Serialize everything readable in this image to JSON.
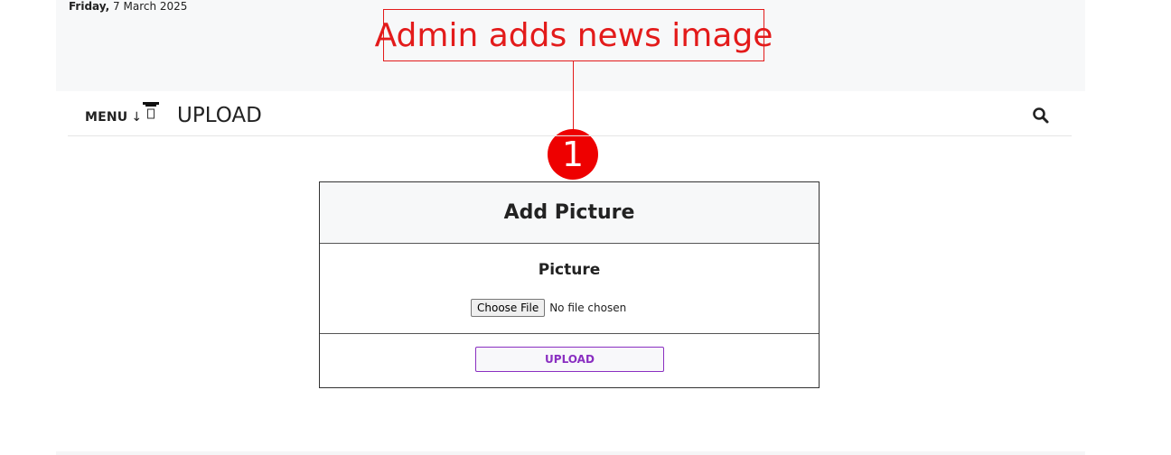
{
  "header": {
    "date_day": "Friday,",
    "date_rest": " 7 March 2025"
  },
  "annotation": {
    "text": "Admin adds news image",
    "step_number": "1",
    "color": "#e31b1b"
  },
  "navbar": {
    "menu_label": "MENU",
    "menu_arrow": "↓",
    "title": "UPLOAD",
    "icons": [
      "tray-icon",
      "search-icon"
    ]
  },
  "form": {
    "title": "Add Picture",
    "field_label": "Picture",
    "file_button_label": "Choose File",
    "file_status": "No file chosen",
    "submit_label": "UPLOAD",
    "accent_color": "#8a2fc1"
  }
}
